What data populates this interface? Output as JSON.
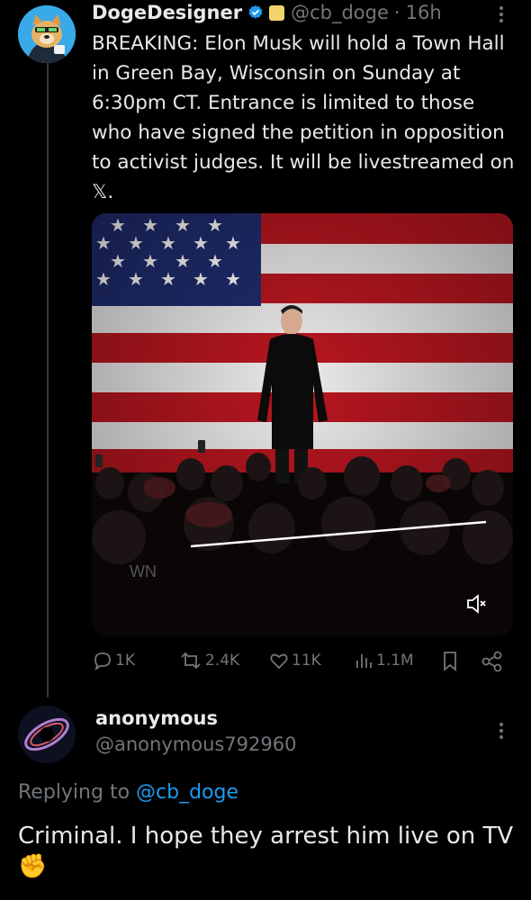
{
  "tweet": {
    "author_name": "DogeDesigner",
    "handle": "@cb_doge",
    "separator": "·",
    "time": "16h",
    "text": "BREAKING: Elon Musk will hold a Town Hall in Green Bay, Wisconsin on Sunday at 6:30pm CT. Entrance is limited to those who have signed the petition in opposition to activist judges. It will be livestreamed on 𝕏.",
    "media": {
      "video_progress": 0.0,
      "watermark": "WN",
      "mute_icon": "speaker-muted-icon"
    },
    "actions": {
      "replies": "1K",
      "reposts": "2.4K",
      "likes": "11K",
      "views": "1.1M"
    },
    "colors": {
      "verified": "#1d9bf0",
      "muted_text": "#71767b",
      "link": "#1d9bf0"
    }
  },
  "reply": {
    "author_name": "anonymous",
    "handle": "@anonymous792960",
    "replying_prefix": "Replying to",
    "replying_to": "@cb_doge",
    "text": "Criminal. I hope they arrest him live on TV",
    "emoji": "✊"
  }
}
